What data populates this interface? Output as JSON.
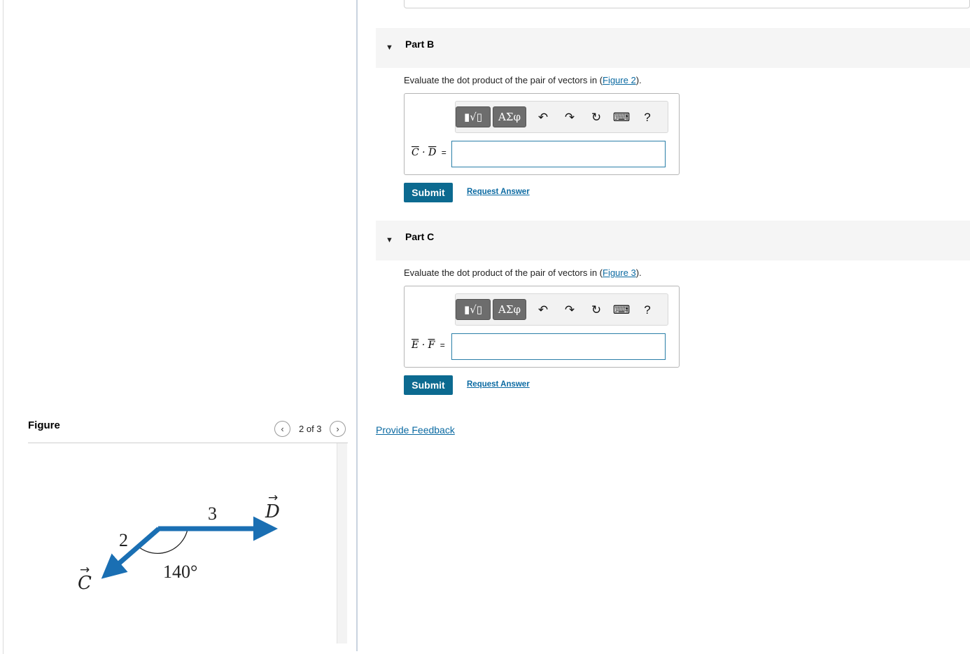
{
  "figure_panel": {
    "title": "Figure",
    "counter": "2 of 3",
    "prev_icon": "chevron-left-icon",
    "next_icon": "chevron-right-icon",
    "diagram": {
      "vector_C_label": "C",
      "vector_D_label": "D",
      "magnitude_C": "2",
      "magnitude_D": "3",
      "angle": "140°",
      "vector_color": "#1a6fb3"
    }
  },
  "parts": [
    {
      "name": "Part B",
      "prompt_prefix": "Evaluate the dot product of the pair of vectors in (",
      "figure_link": "Figure 2",
      "prompt_suffix": ").",
      "equation": {
        "a": "C",
        "b": "D",
        "dot": "·",
        "equals": "="
      },
      "input_value": "",
      "submit_label": "Submit",
      "request_label": "Request Answer"
    },
    {
      "name": "Part C",
      "prompt_prefix": "Evaluate the dot product of the pair of vectors in (",
      "figure_link": "Figure 3",
      "prompt_suffix": ").",
      "equation": {
        "a": "E",
        "b": "F",
        "dot": "·",
        "equals": "="
      },
      "input_value": "",
      "submit_label": "Submit",
      "request_label": "Request Answer"
    }
  ],
  "toolbar": {
    "greek_label": "ΑΣφ",
    "help_label": "?",
    "icons": [
      "templates-icon",
      "greek-symbols-icon",
      "undo-icon",
      "redo-icon",
      "reset-icon",
      "keyboard-icon",
      "help-icon"
    ]
  },
  "colors": {
    "primary": "#0c6a90",
    "link": "#0b6aa2",
    "header_bg": "#f5f5f5"
  },
  "feedback_label": "Provide Feedback"
}
